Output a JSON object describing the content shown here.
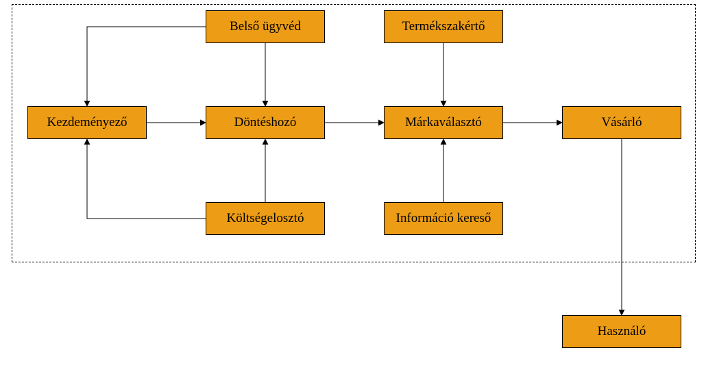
{
  "diagram": {
    "nodes": {
      "belso_ugyved": {
        "label": "Belső ügyvéd"
      },
      "termekszakerto": {
        "label": "Termékszakértő"
      },
      "kezdemenyezo": {
        "label": "Kezdeményező"
      },
      "donteshozo": {
        "label": "Döntéshozó"
      },
      "markavalaszto": {
        "label": "Márkaválasztó"
      },
      "vasarlo": {
        "label": "Vásárló"
      },
      "koltsegeloszto": {
        "label": "Költségelosztó"
      },
      "informacio_kereso": {
        "label": "Információ kereső"
      },
      "hasznalo": {
        "label": "Használó"
      }
    },
    "edges": [
      {
        "from": "belso_ugyved",
        "to": "kezdemenyezo"
      },
      {
        "from": "belso_ugyved",
        "to": "donteshozo"
      },
      {
        "from": "termekszakerto",
        "to": "markavalaszto"
      },
      {
        "from": "kezdemenyezo",
        "to": "donteshozo"
      },
      {
        "from": "donteshozo",
        "to": "markavalaszto"
      },
      {
        "from": "markavalaszto",
        "to": "vasarlo"
      },
      {
        "from": "koltsegeloszto",
        "to": "kezdemenyezo"
      },
      {
        "from": "koltsegeloszto",
        "to": "donteshozo"
      },
      {
        "from": "informacio_kereso",
        "to": "markavalaszto"
      },
      {
        "from": "vasarlo",
        "to": "hasznalo"
      }
    ]
  }
}
